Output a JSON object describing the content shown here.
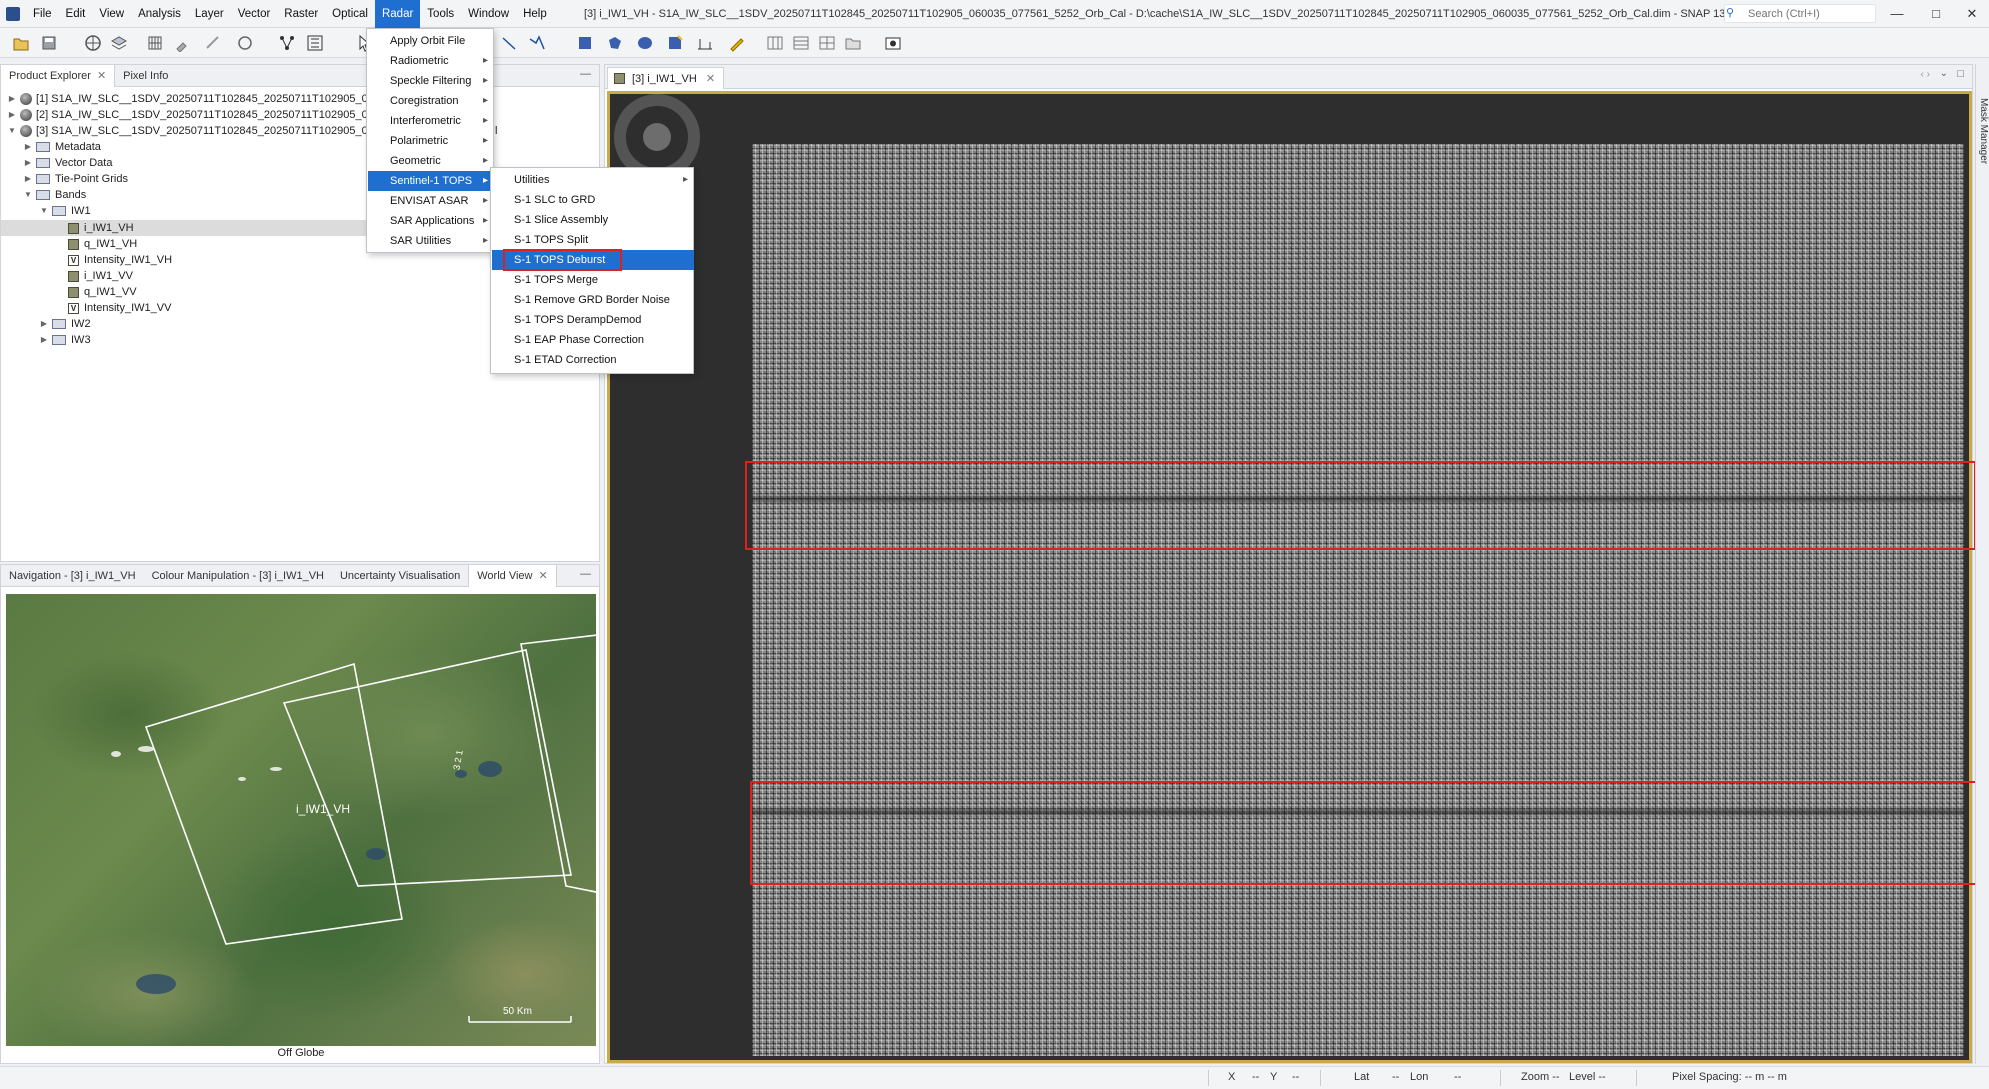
{
  "titlebar": {
    "window_title": "[3] i_IW1_VH - S1A_IW_SLC__1SDV_20250711T102845_20250711T102905_060035_077561_5252_Orb_Cal - D:\\cache\\S1A_IW_SLC__1SDV_20250711T102845_20250711T102905_060035_077561_5252_Orb_Cal.dim - SNAP 13",
    "search_placeholder": "Search (Ctrl+I)",
    "minimize": "—",
    "maximize": "□",
    "close": "✕"
  },
  "menubar": [
    "File",
    "Edit",
    "View",
    "Analysis",
    "Layer",
    "Vector",
    "Raster",
    "Optical",
    "Radar",
    "Tools",
    "Window",
    "Help"
  ],
  "radar_menu": [
    "Apply Orbit File",
    "Radiometric",
    "Speckle Filtering",
    "Coregistration",
    "Interferometric",
    "Polarimetric",
    "Geometric",
    "Sentinel-1 TOPS",
    "ENVISAT ASAR",
    "SAR Applications",
    "SAR Utilities"
  ],
  "tops_menu": [
    "Utilities",
    "S-1 SLC to GRD",
    "S-1 Slice Assembly",
    "S-1 TOPS Split",
    "S-1 TOPS Deburst",
    "S-1 TOPS Merge",
    "S-1 Remove GRD Border Noise",
    "S-1 TOPS DerampDemod",
    "S-1 EAP Phase Correction",
    "S-1 ETAD Correction"
  ],
  "explorer": {
    "tabs": [
      "Product Explorer",
      "Pixel Info"
    ],
    "products": [
      "[1] S1A_IW_SLC__1SDV_20250711T102845_20250711T102905_060",
      "[2] S1A_IW_SLC__1SDV_20250711T102845_20250711T102905_060",
      "[3] S1A_IW_SLC__1SDV_20250711T102845_20250711T102905_060"
    ],
    "product3_tail": "l",
    "folders": [
      "Metadata",
      "Vector Data",
      "Tie-Point Grids",
      "Bands"
    ],
    "group_iw1": "IW1",
    "bands": [
      "i_IW1_VH",
      "q_IW1_VH",
      "Intensity_IW1_VH",
      "i_IW1_VV",
      "q_IW1_VV",
      "Intensity_IW1_VV"
    ],
    "groups_other": [
      "IW2",
      "IW3"
    ]
  },
  "nav_tabs": [
    "Navigation - [3] i_IW1_VH",
    "Colour Manipulation - [3] i_IW1_VH",
    "Uncertainty Visualisation",
    "World View"
  ],
  "worldview": {
    "label": "i_IW1_VH",
    "stack_labels": [
      "3",
      "2",
      "1"
    ],
    "scale": "50 Km",
    "footer": "Off Globe"
  },
  "image_view": {
    "tab_label": "[3] i_IW1_VH"
  },
  "mask_manager": "Mask Manager",
  "statusbar": {
    "x": "X",
    "x_val": "--",
    "y": "Y",
    "y_val": "--",
    "lat": "Lat",
    "lat_val": "--",
    "lon": "Lon",
    "lon_val": "--",
    "zoom": "Zoom --",
    "level": "Level --",
    "pixel_spacing": "Pixel Spacing: -- m -- m"
  },
  "colors": {
    "menu_highlight": "#1f6fd1",
    "annotation_red": "#e02020",
    "view_border": "#c9a94a"
  }
}
